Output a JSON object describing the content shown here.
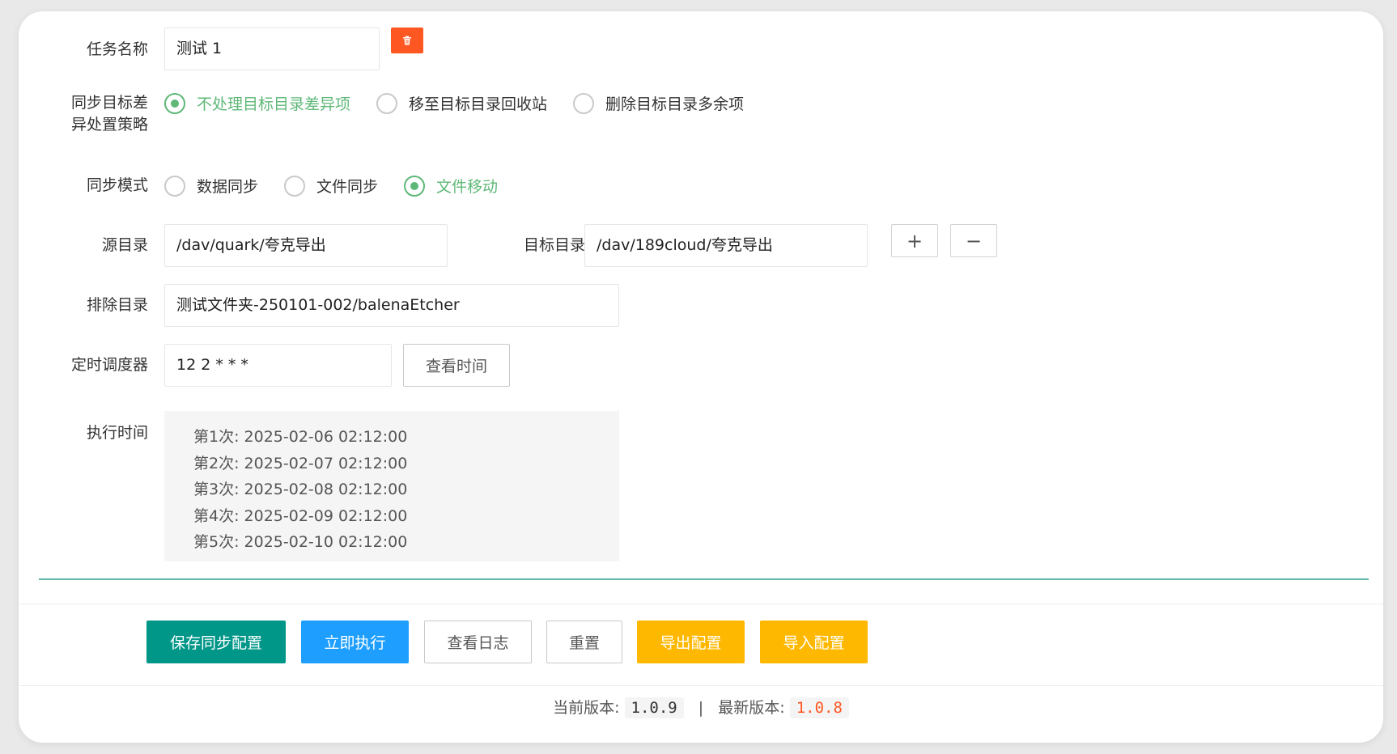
{
  "form": {
    "task_name_label": "任务名称",
    "task_name_value": "测试 1",
    "strategy_label_line1": "同步目标差",
    "strategy_label_line2": "异处置策略",
    "strategy_options": [
      {
        "label": "不处理目标目录差异项",
        "checked": true
      },
      {
        "label": "移至目标目录回收站",
        "checked": false
      },
      {
        "label": "删除目标目录多余项",
        "checked": false
      }
    ],
    "mode_label": "同步模式",
    "mode_options": [
      {
        "label": "数据同步",
        "checked": false
      },
      {
        "label": "文件同步",
        "checked": false
      },
      {
        "label": "文件移动",
        "checked": true
      }
    ],
    "source_label": "源目录",
    "source_value": "/dav/quark/夸克导出",
    "target_label": "目标目录",
    "target_value": "/dav/189cloud/夸克导出",
    "add_symbol": "+",
    "remove_symbol": "−",
    "exclude_label": "排除目录",
    "exclude_value": "测试文件夹-250101-002/balenaEtcher",
    "cron_label": "定时调度器",
    "cron_value": "12 2 * * *",
    "view_time_button": "查看时间",
    "exec_time_label": "执行时间",
    "exec_times": [
      "第1次: 2025-02-06 02:12:00",
      "第2次: 2025-02-07 02:12:00",
      "第3次: 2025-02-08 02:12:00",
      "第4次: 2025-02-09 02:12:00",
      "第5次: 2025-02-10 02:12:00"
    ]
  },
  "actions": {
    "save": "保存同步配置",
    "run": "立即执行",
    "logs": "查看日志",
    "reset": "重置",
    "export": "导出配置",
    "import": "导入配置"
  },
  "footer": {
    "current_label": "当前版本:",
    "current_version": "1.0.9",
    "separator": "|",
    "latest_label": "最新版本:",
    "latest_version": "1.0.8"
  },
  "colors": {
    "accent_green": "#5fb878",
    "save_button": "#009688",
    "run_button": "#1e9fff",
    "export_import_button": "#ffb800",
    "delete_button": "#ff5722",
    "latest_version": "#ff5722"
  },
  "icons": {
    "delete": "trash-icon"
  }
}
